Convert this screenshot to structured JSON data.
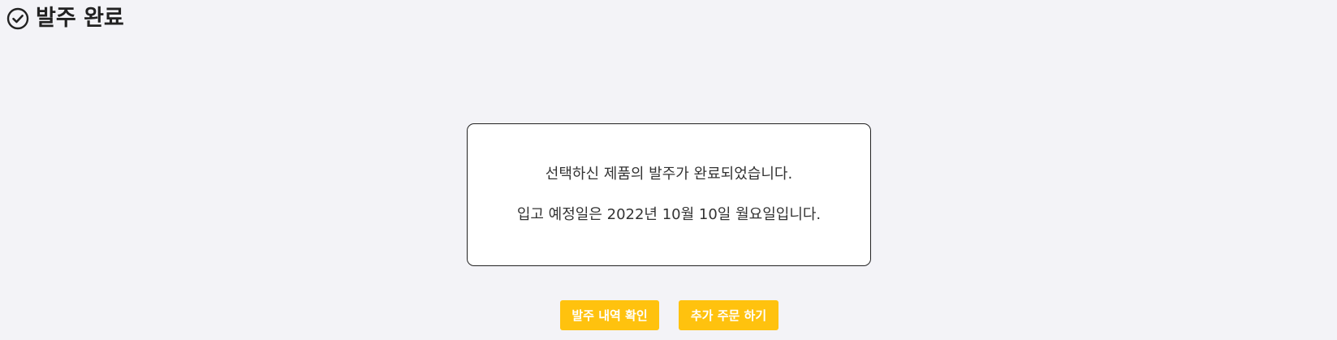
{
  "header": {
    "icon": "check-circle-icon",
    "title": "발주 완료"
  },
  "message": {
    "line1": "선택하신 제품의 발주가 완료되었습니다.",
    "line2": "입고 예정일은 2022년 10월 10일 월요일입니다."
  },
  "actions": {
    "view_order_label": "발주 내역 확인",
    "add_order_label": "추가 주문 하기"
  },
  "colors": {
    "background": "#f3f3f7",
    "button": "#ffc20e",
    "button_text": "#ffffff",
    "border": "#222222"
  }
}
